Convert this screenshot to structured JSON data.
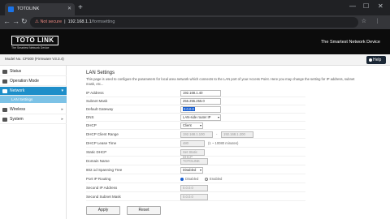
{
  "browser": {
    "tab_title": "TOTOLINK",
    "url_warning": "⚠ Not secure",
    "url_host": "192.168.1.1",
    "url_path": "/formsetting"
  },
  "header": {
    "logo": "TOTO LINK",
    "logo_tagline": "The Smartest Network Device",
    "slogan": "The Smartest Network Device",
    "model": "Model No. CP300 (Firmware V3.3.4)",
    "help_label": "Help"
  },
  "sidebar": {
    "items": [
      {
        "label": "Status"
      },
      {
        "label": "Operation Mode"
      },
      {
        "label": "Network"
      },
      {
        "label": "Wireless"
      },
      {
        "label": "System"
      }
    ],
    "sub_items": [
      {
        "label": "LAN Settings"
      }
    ]
  },
  "main": {
    "title": "LAN Settings",
    "description": "This page is used to configure the parameters for local area network which connects to the LAN port of your Access Point. Here you may change the setting for IP address, subnet mask, etc...",
    "fields": {
      "ip_label": "IP Address",
      "ip_value": "192.168.1.40",
      "mask_label": "Subnet Mask",
      "mask_value": "255.255.255.0",
      "gw_label": "Default Gateway",
      "gw_value": "0.0.0.0",
      "dns_label": "DNS",
      "dns_value": "LAN-side router IP",
      "dhcp_label": "DHCP",
      "dhcp_value": "Client",
      "range_label": "DHCP Client Range",
      "range_start": "192.168.1.100",
      "range_end": "192.168.1.200",
      "lease_label": "DHCP Lease Time",
      "lease_value": "480",
      "lease_unit": "(1 ~ 10080 minutes)",
      "static_label": "Static DHCP",
      "static_value": "Set Static DHCP",
      "domain_label": "Domain Name",
      "domain_value": "TOTOLINK",
      "stp_label": "802.1d Spanning Tree",
      "stp_value": "Disabled",
      "relay_label": "Port IP Routing",
      "relay_disabled": "Disabled",
      "relay_enabled": "Enabled",
      "sip_label": "Second IP Address",
      "sip_value": "0.0.0.0",
      "smask_label": "Second Subnet Mask",
      "smask_value": "0.0.0.0"
    },
    "apply_label": "Apply",
    "reset_label": "Reset"
  }
}
